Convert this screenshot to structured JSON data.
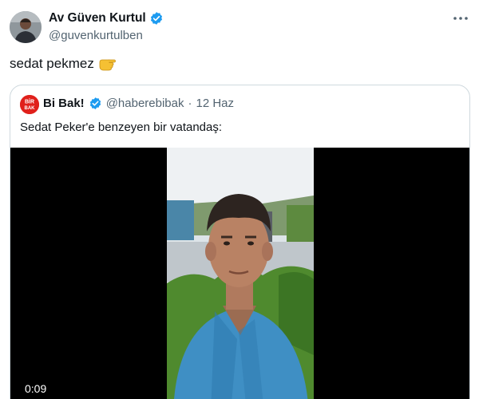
{
  "tweet": {
    "author": {
      "display_name": "Av Güven Kurtul",
      "handle": "@guvenkurtulben",
      "verified": true
    },
    "text": "sedat pekmez",
    "emoji": "hand-pointing-icon",
    "more_icon": "more-options-icon"
  },
  "quote": {
    "author": {
      "display_name": "Bi Bak!",
      "handle": "@haberebibak",
      "verified": true,
      "avatar_text": "BİR BAK"
    },
    "separator": "·",
    "date": "12 Haz",
    "text": "Sedat Peker'e benzeyen bir vatandaş:",
    "video": {
      "duration": "0:09"
    }
  },
  "colors": {
    "accent": "#1d9bf0",
    "text_primary": "#0f1419",
    "text_secondary": "#536471",
    "border": "#cfd9de",
    "brand_red": "#e0201b"
  }
}
